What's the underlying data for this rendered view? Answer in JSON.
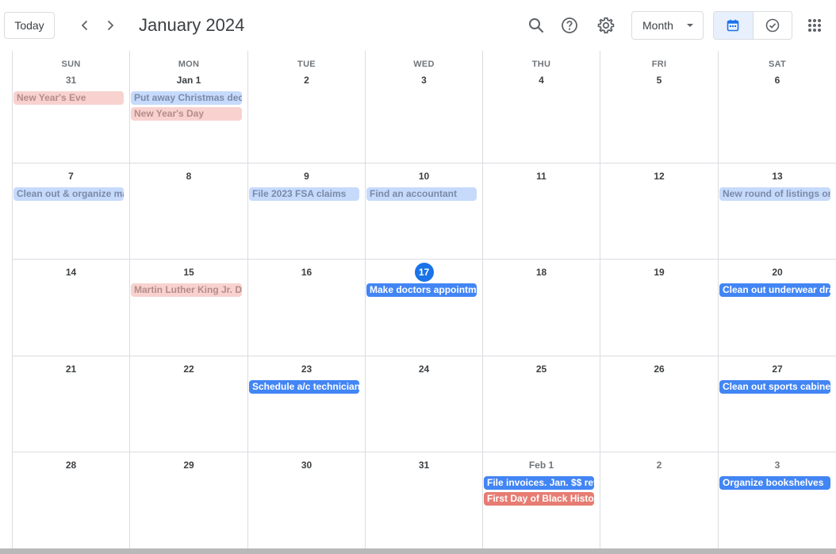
{
  "toolbar": {
    "today_label": "Today",
    "title": "January 2024",
    "view_label": "Month",
    "icons": [
      "chevron-left",
      "chevron-right",
      "search",
      "help",
      "settings",
      "calendar",
      "tasks",
      "apps"
    ]
  },
  "colors": {
    "accent": "#1a73e8",
    "event_blue": "#4285f4",
    "event_red": "#e67c73",
    "past_blue": "#c6dafc",
    "past_red": "#f8d2cf"
  },
  "weekdays": [
    "SUN",
    "MON",
    "TUE",
    "WED",
    "THU",
    "FRI",
    "SAT"
  ],
  "weeks": [
    {
      "days": [
        {
          "label": "31",
          "muted": true,
          "events": [
            {
              "title": "New Year's Eve",
              "style": "past-red"
            }
          ]
        },
        {
          "label": "Jan 1",
          "events": [
            {
              "title": "Put away Christmas dec",
              "style": "past-blue"
            },
            {
              "title": "New Year's Day",
              "style": "past-red"
            }
          ]
        },
        {
          "label": "2",
          "events": []
        },
        {
          "label": "3",
          "events": []
        },
        {
          "label": "4",
          "events": []
        },
        {
          "label": "5",
          "events": []
        },
        {
          "label": "6",
          "events": []
        }
      ]
    },
    {
      "days": [
        {
          "label": "7",
          "events": [
            {
              "title": "Clean out & organize ma",
              "style": "past-blue"
            }
          ]
        },
        {
          "label": "8",
          "events": []
        },
        {
          "label": "9",
          "events": [
            {
              "title": "File 2023 FSA claims",
              "style": "past-blue"
            }
          ]
        },
        {
          "label": "10",
          "events": [
            {
              "title": "Find an accountant",
              "style": "past-blue"
            }
          ]
        },
        {
          "label": "11",
          "events": []
        },
        {
          "label": "12",
          "events": []
        },
        {
          "label": "13",
          "events": [
            {
              "title": "New round of listings on",
              "style": "past-blue"
            }
          ]
        }
      ]
    },
    {
      "days": [
        {
          "label": "14",
          "events": []
        },
        {
          "label": "15",
          "events": [
            {
              "title": "Martin Luther King Jr. Da",
              "style": "past-red"
            }
          ]
        },
        {
          "label": "16",
          "events": []
        },
        {
          "label": "17",
          "today": true,
          "events": [
            {
              "title": "Make doctors appointme",
              "style": "blue"
            }
          ]
        },
        {
          "label": "18",
          "events": []
        },
        {
          "label": "19",
          "events": []
        },
        {
          "label": "20",
          "events": [
            {
              "title": "Clean out underwear dra",
              "style": "blue"
            }
          ]
        }
      ]
    },
    {
      "days": [
        {
          "label": "21",
          "events": []
        },
        {
          "label": "22",
          "events": []
        },
        {
          "label": "23",
          "events": [
            {
              "title": "Schedule a/c technician",
              "style": "blue"
            }
          ]
        },
        {
          "label": "24",
          "events": []
        },
        {
          "label": "25",
          "events": []
        },
        {
          "label": "26",
          "events": []
        },
        {
          "label": "27",
          "events": [
            {
              "title": "Clean out sports cabinet",
              "style": "blue"
            }
          ]
        }
      ]
    },
    {
      "days": [
        {
          "label": "28",
          "events": []
        },
        {
          "label": "29",
          "events": []
        },
        {
          "label": "30",
          "events": []
        },
        {
          "label": "31",
          "events": []
        },
        {
          "label": "Feb 1",
          "muted": true,
          "events": [
            {
              "title": "File invoices. Jan. $$ rev",
              "style": "blue"
            },
            {
              "title": "First Day of Black Histor",
              "style": "red"
            }
          ]
        },
        {
          "label": "2",
          "muted": true,
          "events": []
        },
        {
          "label": "3",
          "muted": true,
          "events": [
            {
              "title": "Organize bookshelves",
              "style": "blue"
            }
          ]
        }
      ]
    }
  ]
}
